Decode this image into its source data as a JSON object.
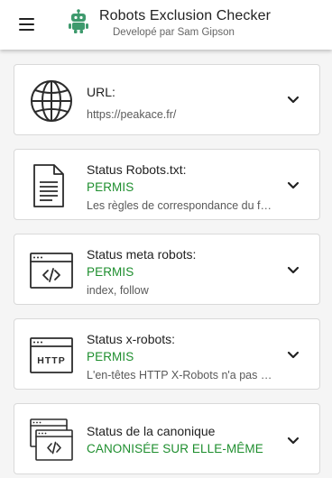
{
  "header": {
    "title": "Robots Exclusion Checker",
    "subtitle": "Developé par Sam Gipson"
  },
  "colors": {
    "accent_green": "#1e8e2e",
    "logo_green": "#3e9a6d"
  },
  "cards": [
    {
      "icon": "globe-icon",
      "title": "URL:",
      "detail": "https://peakace.fr/"
    },
    {
      "icon": "document-icon",
      "title": "Status Robots.txt:",
      "status": "PERMIS",
      "detail": "Les règles de correspondance du fichier robots.txt"
    },
    {
      "icon": "code-window-icon",
      "title": "Status meta robots:",
      "status": "PERMIS",
      "detail": "index, follow"
    },
    {
      "icon": "http-window-icon",
      "icon_text": "HTTP",
      "title": "Status x-robots:",
      "status": "PERMIS",
      "detail": "L'en-têtes HTTP X-Robots n'a pas été trouvé"
    },
    {
      "icon": "canonical-windows-icon",
      "title": "Status de la canonique",
      "status": "CANONISÉE SUR ELLE-MÊME"
    }
  ]
}
